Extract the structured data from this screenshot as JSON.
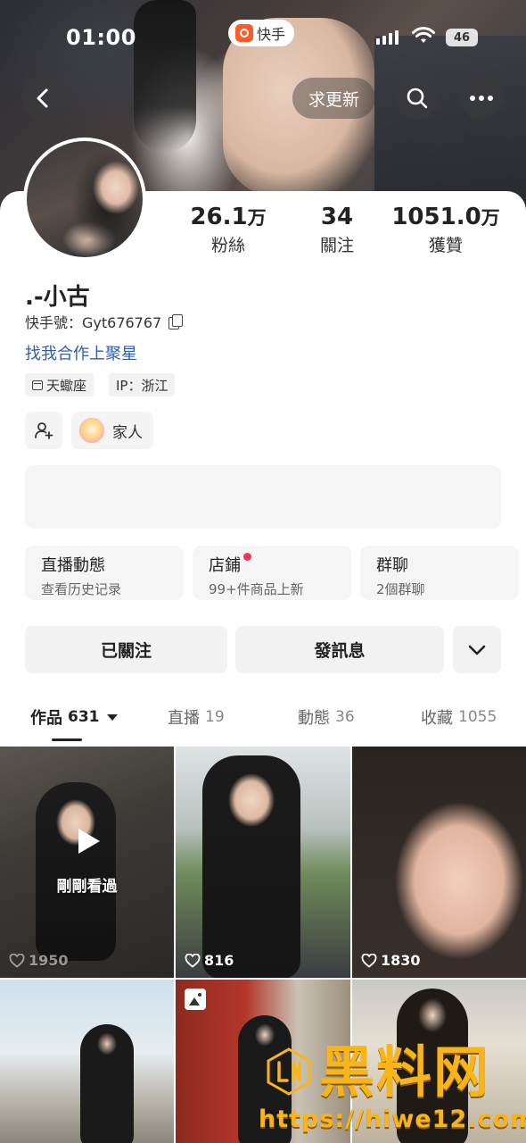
{
  "status_bar": {
    "time": "01:00",
    "app_name": "快手",
    "battery": "46"
  },
  "top_nav": {
    "update_label": "求更新"
  },
  "profile": {
    "stats": [
      {
        "value": "26.1",
        "unit": "万",
        "label": "粉絲"
      },
      {
        "value": "34",
        "unit": "",
        "label": "關注"
      },
      {
        "value": "1051.0",
        "unit": "万",
        "label": "獲贊"
      }
    ],
    "username": ".-小古",
    "kuaishou_id": "快手號：Gyt676767",
    "bio_link": "找我合作上聚星",
    "tags": {
      "zodiac": "天蠍座",
      "ip": "IP：浙江"
    },
    "family_label": "家人"
  },
  "features": [
    {
      "title": "直播動態",
      "subtitle": "查看历史记录"
    },
    {
      "title": "店鋪",
      "subtitle": "99+件商品上新"
    },
    {
      "title": "群聊",
      "subtitle": "2個群聊"
    }
  ],
  "actions": {
    "followed": "已關注",
    "message": "發訊息"
  },
  "tabs": [
    {
      "label": "作品",
      "count": "631"
    },
    {
      "label": "直播",
      "count": "19"
    },
    {
      "label": "動態",
      "count": "36"
    },
    {
      "label": "收藏",
      "count": "1055"
    }
  ],
  "grid": [
    {
      "likes": "1950",
      "overlay": "剛剛看過"
    },
    {
      "likes": "816"
    },
    {
      "likes": "1830"
    }
  ],
  "watermark": {
    "brand": "黑料网",
    "url": "https://hiwe12.com"
  },
  "colors": {
    "link_blue": "#2f5ea8",
    "red_dot": "#ff3158",
    "watermark_gold": "#f7b51a",
    "brand_orange": "#ff5a2a"
  }
}
